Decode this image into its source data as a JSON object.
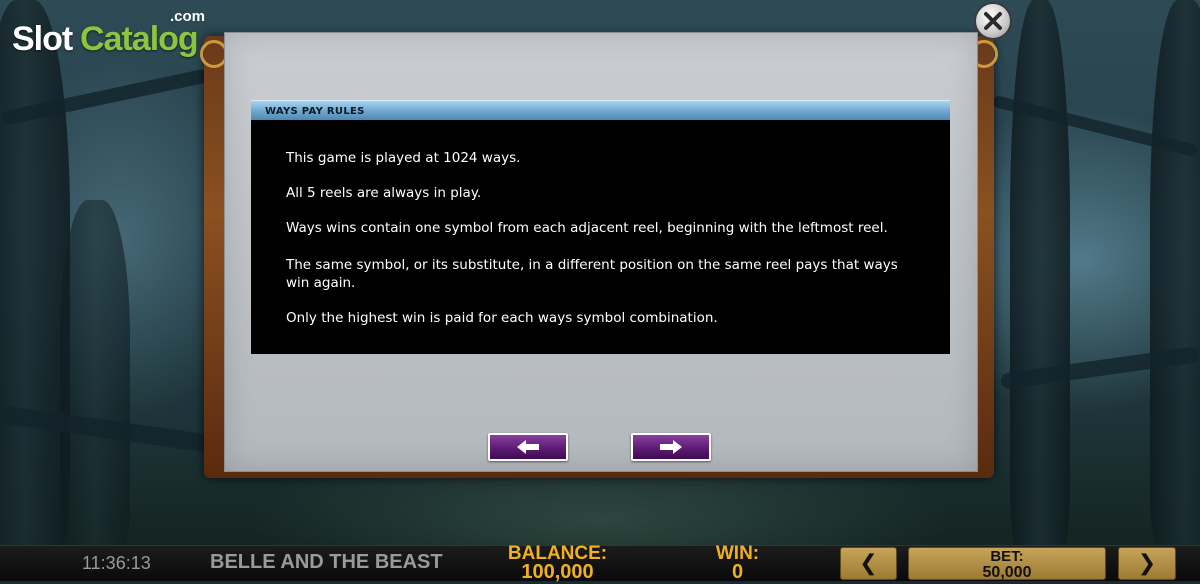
{
  "logo": {
    "part1": "Slot",
    "part2": "Catalog",
    "suffix": ".com"
  },
  "rules": {
    "title": "WAYS PAY RULES",
    "lines": [
      "This game is played at 1024 ways.",
      "All 5 reels are always in play.",
      "Ways wins contain one symbol from each adjacent reel, beginning with the leftmost reel.",
      "The same symbol, or its substitute, in a different position on the same reel pays that ways win again.",
      "Only the highest win is paid for each ways symbol combination."
    ]
  },
  "navigation": {
    "prev_icon": "arrow-left-icon",
    "next_icon": "arrow-right-icon",
    "close_icon": "close-icon"
  },
  "status_bar": {
    "clock": "11:36:13",
    "game_title": "BELLE AND THE BEAST",
    "balance_label": "BALANCE:",
    "balance_value": "100,000",
    "win_label": "WIN:",
    "win_value": "0",
    "bet_label": "BET:",
    "bet_value": "50,000",
    "bet_prev": "❮",
    "bet_next": "❯"
  },
  "colors": {
    "header_blue": "#6fa8cf",
    "button_purple": "#5a1a70",
    "status_gold": "#f2b01e",
    "bet_button": "#c7a45a"
  }
}
